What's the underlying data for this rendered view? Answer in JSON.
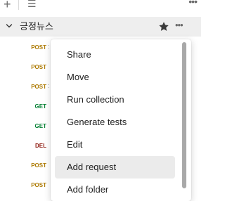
{
  "toolbar": {
    "add_icon": "plus-icon",
    "filter_icon": "filter-lines-icon",
    "more_icon": "more-horizontal-icon",
    "add_glyph": "+",
    "filter_glyph": "☰",
    "more_glyph": "•••"
  },
  "collection": {
    "name": "긍정뉴스",
    "more_glyph": "•••"
  },
  "requests": [
    {
      "method": "POST",
      "suffix": ":"
    },
    {
      "method": "POST",
      "suffix": ""
    },
    {
      "method": "POST",
      "suffix": ":"
    },
    {
      "method": "GET",
      "suffix": ""
    },
    {
      "method": "GET",
      "suffix": ""
    },
    {
      "method": "DEL",
      "suffix": ""
    },
    {
      "method": "POST",
      "suffix": ""
    },
    {
      "method": "POST",
      "suffix": ""
    }
  ],
  "menu": {
    "items": [
      {
        "label": "Share"
      },
      {
        "label": "Move"
      },
      {
        "label": "Run collection"
      },
      {
        "label": "Generate tests"
      },
      {
        "label": "Edit"
      },
      {
        "label": "Add request"
      },
      {
        "label": "Add folder"
      }
    ]
  },
  "colors": {
    "post": "#ad7a03",
    "get": "#007f31",
    "del": "#8e1a10",
    "selected_row": "#eeeeee",
    "menu_hover": "#ebebeb",
    "scroll_thumb": "#a8a8a8"
  }
}
